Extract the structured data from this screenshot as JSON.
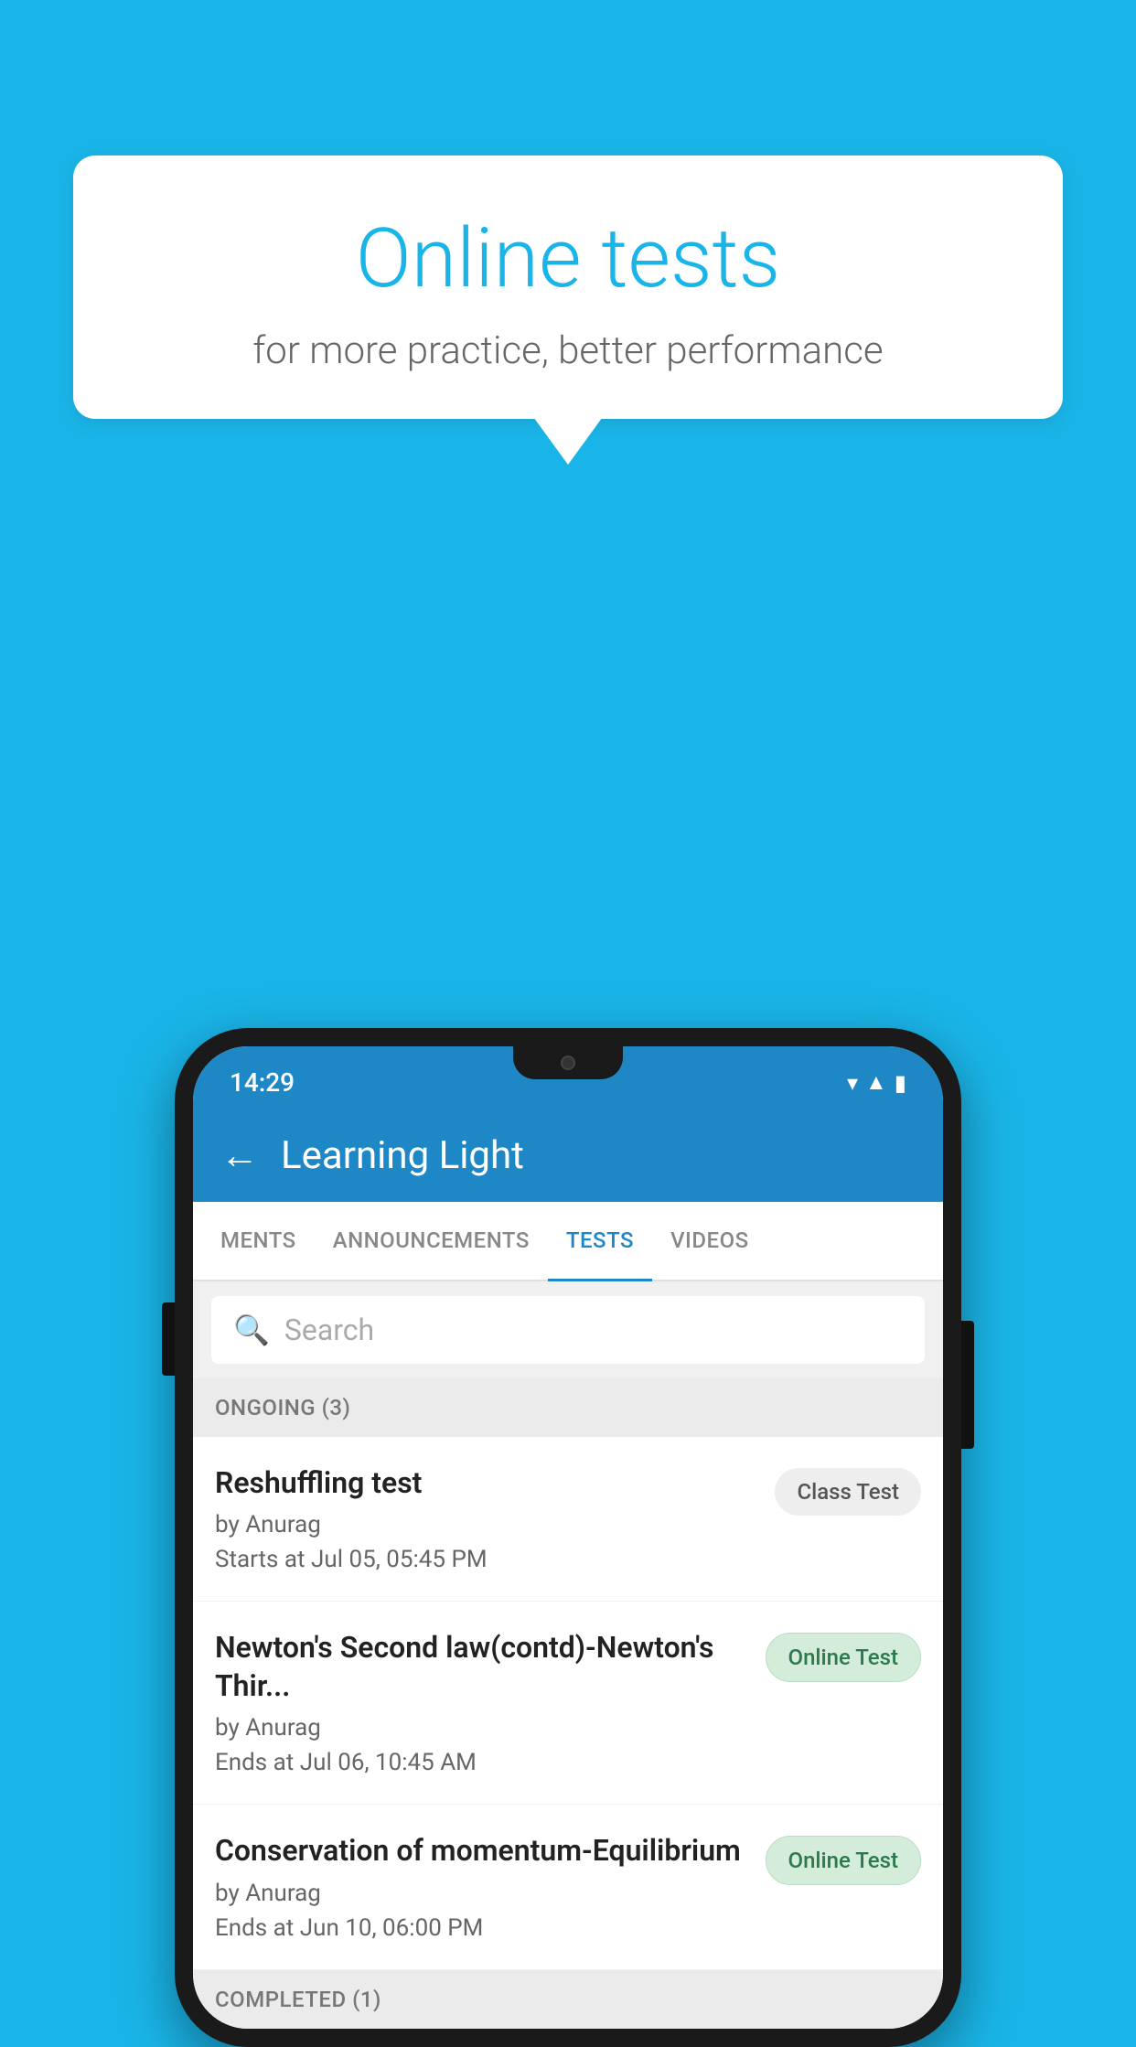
{
  "background": {
    "color": "#1ab5e8"
  },
  "speech_bubble": {
    "title": "Online tests",
    "subtitle": "for more practice, better performance"
  },
  "phone": {
    "status_bar": {
      "time": "14:29"
    },
    "app_bar": {
      "back_label": "←",
      "title": "Learning Light"
    },
    "tabs": [
      {
        "label": "MENTS",
        "active": false
      },
      {
        "label": "ANNOUNCEMENTS",
        "active": false
      },
      {
        "label": "TESTS",
        "active": true
      },
      {
        "label": "VIDEOS",
        "active": false
      }
    ],
    "search": {
      "placeholder": "Search"
    },
    "ongoing_section": {
      "title": "ONGOING (3)"
    },
    "tests": [
      {
        "name": "Reshuffling test",
        "author": "by Anurag",
        "time_label": "Starts at",
        "time": "Jul 05, 05:45 PM",
        "badge": "Class Test",
        "badge_type": "class"
      },
      {
        "name": "Newton's Second law(contd)-Newton's Thir...",
        "author": "by Anurag",
        "time_label": "Ends at",
        "time": "Jul 06, 10:45 AM",
        "badge": "Online Test",
        "badge_type": "online"
      },
      {
        "name": "Conservation of momentum-Equilibrium",
        "author": "by Anurag",
        "time_label": "Ends at",
        "time": "Jun 10, 06:00 PM",
        "badge": "Online Test",
        "badge_type": "online"
      }
    ],
    "completed_section": {
      "title": "COMPLETED (1)"
    }
  }
}
